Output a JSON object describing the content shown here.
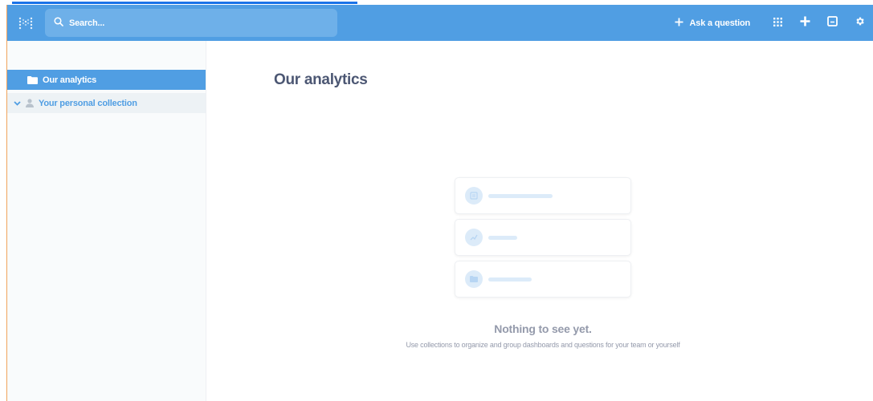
{
  "navbar": {
    "search_placeholder": "Search...",
    "ask_question_label": "Ask a question"
  },
  "sidebar": {
    "items": [
      {
        "label": "Our analytics",
        "active": true
      },
      {
        "label": "Your personal collection",
        "active": false
      }
    ]
  },
  "main": {
    "title": "Our analytics",
    "empty_state": {
      "title": "Nothing to see yet.",
      "subtitle": "Use collections to organize and group dashboards and questions for your team or yourself"
    }
  },
  "colors": {
    "brand": "#509ee3",
    "text_dark": "#4c5773",
    "text_light": "#949aab",
    "placeholder": "#dcebf9"
  }
}
